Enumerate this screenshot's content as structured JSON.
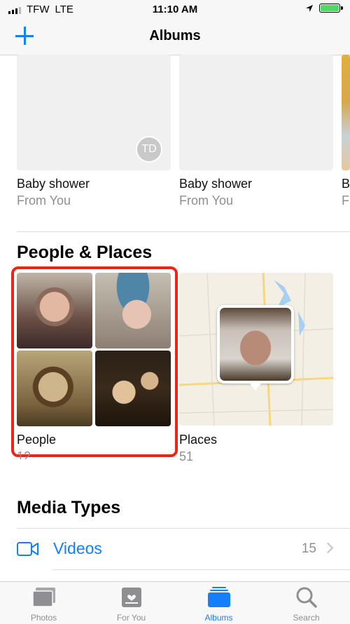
{
  "status_bar": {
    "carrier": "TFW",
    "network": "LTE",
    "time": "11:10 AM"
  },
  "nav": {
    "title": "Albums"
  },
  "shared_albums": [
    {
      "title": "Baby shower",
      "subtitle": "From You",
      "owner_initials": "TD"
    },
    {
      "title": "Baby shower",
      "subtitle": "From You"
    },
    {
      "title": "B",
      "subtitle": "Fr"
    }
  ],
  "people_places": {
    "section_title": "People & Places",
    "people": {
      "label": "People",
      "count": "12"
    },
    "places": {
      "label": "Places",
      "count": "51"
    }
  },
  "media_types": {
    "section_title": "Media Types",
    "videos": {
      "label": "Videos",
      "count": "15"
    }
  },
  "tabs": [
    {
      "label": "Photos",
      "active": false
    },
    {
      "label": "For You",
      "active": false
    },
    {
      "label": "Albums",
      "active": true
    },
    {
      "label": "Search",
      "active": false
    }
  ],
  "colors": {
    "accent": "#147efb",
    "highlight": "#f02414",
    "battery": "#4cd964"
  }
}
